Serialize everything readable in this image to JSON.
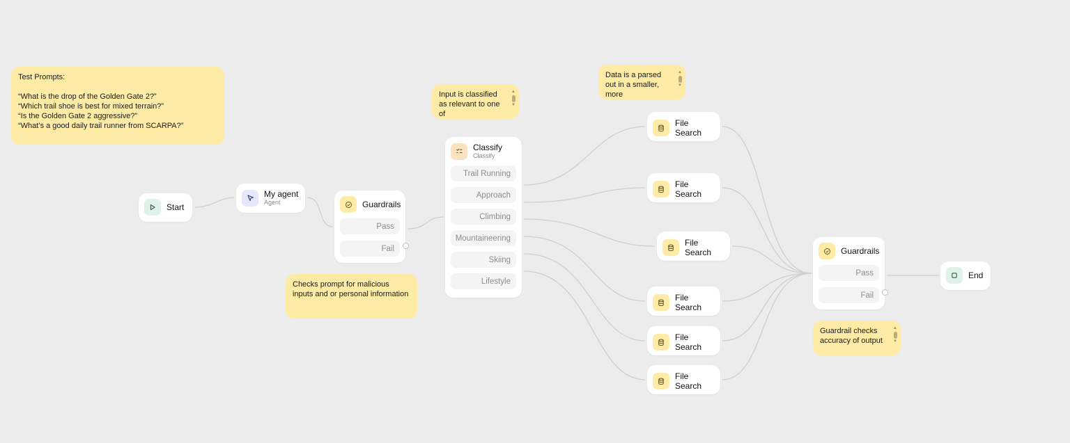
{
  "notes": {
    "test_prompts": {
      "text": "Test Prompts:\n\n“What is the drop of the Golden Gate 2?”\n“Which trail shoe is best for mixed terrain?”\n“Is the Golden Gate 2 aggressive?”\n“What’s a good daily trail runner from SCARPA?”"
    },
    "guardrail_input": {
      "text": "Checks prompt for malicious inputs and or personal information"
    },
    "classify": {
      "text": "Input is classified as relevant to one of"
    },
    "data_parsed": {
      "text": "Data is a parsed out in a smaller, more"
    },
    "guardrail_output": {
      "text": "Guardrail checks accuracy of output"
    }
  },
  "nodes": {
    "start": {
      "title": "Start",
      "icon": "play-icon"
    },
    "agent": {
      "title": "My agent",
      "subtitle": "Agent",
      "icon": "cursor-icon"
    },
    "guardrails_1": {
      "title": "Guardrails",
      "icon": "shield-check-icon",
      "pass": "Pass",
      "fail": "Fail"
    },
    "classify": {
      "title": "Classify",
      "subtitle": "Classify",
      "icon": "list-icon",
      "categories": [
        "Trail Running",
        "Approach",
        "Climbing",
        "Mountaineering",
        "Skiing",
        "Lifestyle"
      ]
    },
    "file_search": {
      "title": "File Search",
      "icon": "database-icon"
    },
    "guardrails_2": {
      "title": "Guardrails",
      "icon": "shield-check-icon",
      "pass": "Pass",
      "fail": "Fail"
    },
    "end": {
      "title": "End",
      "icon": "stop-icon"
    }
  },
  "colors": {
    "canvas": "#ececec",
    "note": "#fdeba6",
    "start_icon_bg": "#dff2ea",
    "agent_icon_bg": "#e5e8fb",
    "guardrail_icon_bg": "#fdeba6",
    "classify_icon_bg": "#fbe3c2",
    "file_search_icon_bg": "#fdeba6",
    "end_icon_bg": "#dff2ea"
  }
}
